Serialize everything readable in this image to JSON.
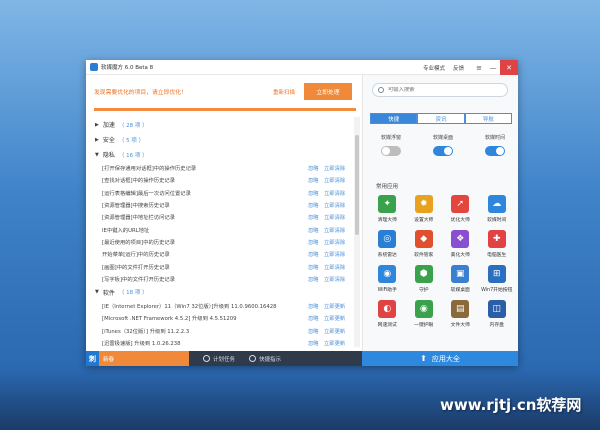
{
  "window": {
    "title": "软媒魔方 6.0 Beta 8",
    "links": [
      "专业模式",
      "反馈"
    ],
    "controls": [
      "≡",
      "—",
      "✕"
    ]
  },
  "notice": {
    "text": "发现需要优化的项目，请立即优化！",
    "cancel": "重新扫描",
    "button": "立即处理",
    "progress": 1.0
  },
  "tree": {
    "sections": [
      {
        "label": "加速",
        "count": "（ 28 项 ）",
        "expanded": false
      },
      {
        "label": "安全",
        "count": "（ 5 项 ）",
        "expanded": false
      },
      {
        "label": "隐私",
        "count": "（ 16 项 ）",
        "expanded": true
      },
      {
        "label": "软件",
        "count": "（ 18 项 ）",
        "expanded": true
      }
    ],
    "privacy_rows": [
      "[打开保存通用对话框]中的操作历史记录",
      "[查找对话框]中的操作历史记录",
      "[运行表格编辑]最后一次访问位置记录",
      "[资源管理器]中搜索历史记录",
      "[资源管理器]中地址栏访问记录",
      "IE中键入的URL地址",
      "[最近使用的项目]中的历史记录",
      "开始菜单[运行]中的历史记录",
      "[画图]中的文件打开历史记录",
      "[写字板]中的文件打开历史记录"
    ],
    "privacy_actions": [
      "忽略",
      "立即清除"
    ],
    "software_rows": [
      "[IE（Internet Explorer）11（Win7 32位版）]升级到 11.0.9600.16428",
      "[Microsoft .NET Framework 4.5.2] 升级到 4.5.51209",
      "[iTunes（32位版）] 升级到 11.2.2.3",
      "[迅雷极速版] 升级到 1.0.26.238"
    ],
    "software_actions": [
      "忽略",
      "立即更新"
    ]
  },
  "right": {
    "search_placeholder": "可输入搜索",
    "tabs": [
      "快捷",
      "资讯",
      "导航"
    ],
    "toggles": [
      {
        "label": "软媒浮窗",
        "on": false
      },
      {
        "label": "软媒桌面",
        "on": true
      },
      {
        "label": "软媒时间",
        "on": true
      }
    ],
    "apps_title": "常用应用",
    "apps": [
      {
        "label": "清理大师",
        "icon": "broom-icon",
        "glyph": "✦",
        "color": "#3aa24a"
      },
      {
        "label": "设置大师",
        "icon": "gear-icon",
        "glyph": "✹",
        "color": "#e8a21f"
      },
      {
        "label": "优化大师",
        "icon": "rocket-icon",
        "glyph": "➚",
        "color": "#e2463f"
      },
      {
        "label": "软媒时间",
        "icon": "cloud-icon",
        "glyph": "☁",
        "color": "#2e86dd"
      },
      {
        "label": "系统雷达",
        "icon": "radar-icon",
        "glyph": "◎",
        "color": "#2a7fd4"
      },
      {
        "label": "软件管家",
        "icon": "software-manager-icon",
        "glyph": "◆",
        "color": "#e0502e"
      },
      {
        "label": "美化大师",
        "icon": "palette-icon",
        "glyph": "❖",
        "color": "#8a4fd0"
      },
      {
        "label": "电脑医生",
        "icon": "medical-kit-icon",
        "glyph": "✚",
        "color": "#e04343"
      },
      {
        "label": "WiFi助手",
        "icon": "wifi-icon",
        "glyph": "◉",
        "color": "#2e86dd"
      },
      {
        "label": "守护",
        "icon": "guard-icon",
        "glyph": "⬢",
        "color": "#3aa24a"
      },
      {
        "label": "软媒桌面",
        "icon": "desktop-icon",
        "glyph": "▣",
        "color": "#3a7fd0"
      },
      {
        "label": "Win7开始按钮",
        "icon": "start-button-icon",
        "glyph": "⊞",
        "color": "#2a6fc0"
      },
      {
        "label": "网速测试",
        "icon": "speed-test-icon",
        "glyph": "◐",
        "color": "#e04343"
      },
      {
        "label": "一键护眼",
        "icon": "eye-icon",
        "glyph": "◉",
        "color": "#3aa24a"
      },
      {
        "label": "文件大师",
        "icon": "file-icon",
        "glyph": "▤",
        "color": "#8a6a3a"
      },
      {
        "label": "内存盘",
        "icon": "memory-disk-icon",
        "glyph": "◫",
        "color": "#2a5fa8"
      }
    ]
  },
  "bottom": {
    "brand_glyph": "刺",
    "brand_label": "新春",
    "items": [
      "计划任务",
      "快捷指示"
    ],
    "apps_all": "应用大全"
  },
  "watermark": "www.rjtj.cn软荐网"
}
